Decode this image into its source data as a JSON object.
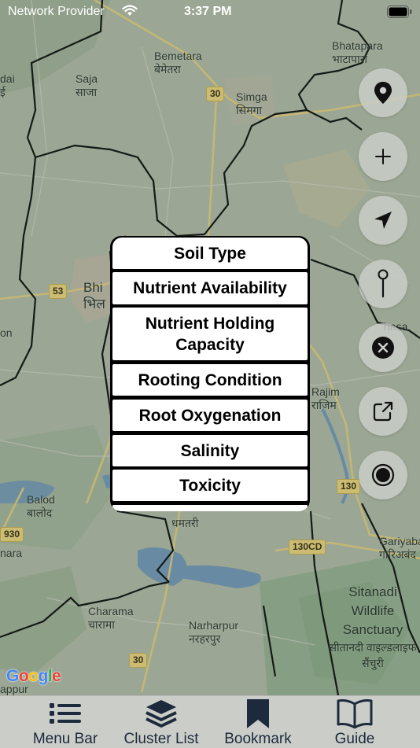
{
  "status_bar": {
    "carrier": "Network Provider",
    "time": "3:37 PM"
  },
  "map": {
    "places": [
      {
        "id": "bhatapara",
        "en": "Bhatapara",
        "hi": "भाटापारा"
      },
      {
        "id": "bemetara",
        "en": "Bemetara",
        "hi": "बेमेतरा"
      },
      {
        "id": "saja",
        "en": "Saja",
        "hi": "साजा"
      },
      {
        "id": "simga",
        "en": "Simga",
        "hi": "सिमगा"
      },
      {
        "id": "dai",
        "en": "dai",
        "hi": "ई"
      },
      {
        "id": "bhilai",
        "en": "Bhi",
        "hi": "भिल"
      },
      {
        "id": "rajim",
        "en": "Rajim",
        "hi": "राजिम"
      },
      {
        "id": "mahasamund",
        "en": "hasa",
        "hi": ""
      },
      {
        "id": "balod",
        "en": "Balod",
        "hi": "बालोद"
      },
      {
        "id": "dhamtari",
        "en": "",
        "hi": "धमतरी"
      },
      {
        "id": "gariyaband",
        "en": "Gariyaba",
        "hi": "गारिअबंद"
      },
      {
        "id": "charama",
        "en": "Charama",
        "hi": "चारामा"
      },
      {
        "id": "narharpur",
        "en": "Narharpur",
        "hi": "नरहरपुर"
      },
      {
        "id": "sitanadi",
        "en": "Sitanadi Wildlife Sanctuary",
        "hi": "सीतानदी वाइल्डलाइफ सैंचुरी"
      },
      {
        "id": "nara",
        "en": "nara",
        "hi": ""
      },
      {
        "id": "appur",
        "en": "appur",
        "hi": ""
      },
      {
        "id": "on",
        "en": "on",
        "hi": ""
      }
    ],
    "shields": [
      {
        "id": "nh30-top",
        "label": "30"
      },
      {
        "id": "nh53",
        "label": "53"
      },
      {
        "id": "nh130",
        "label": "130"
      },
      {
        "id": "nh930",
        "label": "930"
      },
      {
        "id": "nh130cd",
        "label": "130CD"
      },
      {
        "id": "nh30-bottom",
        "label": "30"
      }
    ],
    "google_logo": [
      "G",
      "o",
      "o",
      "g",
      "l",
      "e"
    ],
    "google_colors": [
      "#4285F4",
      "#EA4335",
      "#FBBC05",
      "#4285F4",
      "#34A853",
      "#EA4335"
    ]
  },
  "fabs": [
    {
      "name": "my-location-pin-button",
      "icon": "location-pin-icon"
    },
    {
      "name": "zoom-in-button",
      "icon": "plus-icon"
    },
    {
      "name": "navigate-button",
      "icon": "navigation-arrow-icon"
    },
    {
      "name": "drop-pin-button",
      "icon": "map-pin-icon"
    },
    {
      "name": "clear-button",
      "icon": "close-circle-icon"
    },
    {
      "name": "share-button",
      "icon": "external-link-icon"
    },
    {
      "name": "record-button",
      "icon": "record-icon"
    }
  ],
  "popup": {
    "items": [
      "Soil Type",
      "Nutrient Availability",
      "Nutrient Holding Capacity",
      "Rooting Condition",
      "Root Oxygenation",
      "Salinity",
      "Toxicity"
    ]
  },
  "tab_bar": {
    "tabs": [
      {
        "label": "Menu Bar",
        "icon": "list-icon"
      },
      {
        "label": "Cluster List",
        "icon": "layers-icon"
      },
      {
        "label": "Bookmark",
        "icon": "bookmark-icon"
      },
      {
        "label": "Guide",
        "icon": "book-open-icon"
      }
    ],
    "icon_color": "#1c2a3b"
  }
}
